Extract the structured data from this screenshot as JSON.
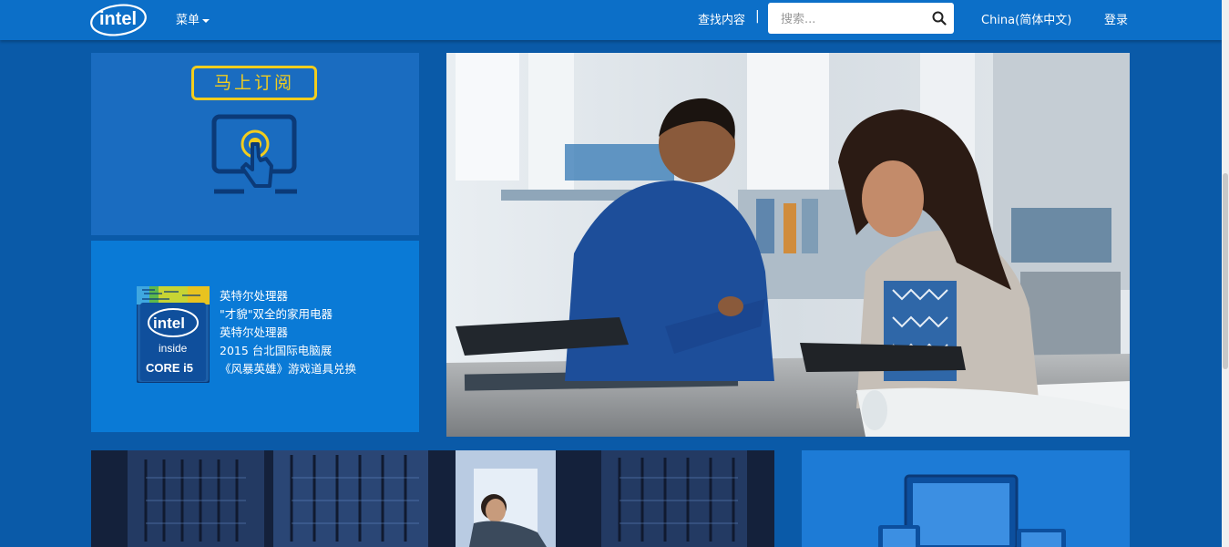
{
  "header": {
    "brand": "intel",
    "menu_label": "菜单",
    "find_content": "查找内容",
    "separator": "|",
    "search_placeholder": "搜索...",
    "language": "China(简体中文)",
    "login": "登录"
  },
  "tiles": {
    "subscribe": {
      "label": "马上订阅"
    },
    "processor": {
      "badge": {
        "brand": "intel",
        "inside": "inside",
        "model": "CORE i5"
      },
      "lines": [
        "英特尔处理器",
        "\"才貌\"双全的家用电器",
        "英特尔处理器",
        "2015 台北国际电脑展",
        "《风暴英雄》游戏道具兑换"
      ]
    }
  },
  "colors": {
    "page_bg": "#0a5aa8",
    "header_bg": "#0c6fc8",
    "accent_yellow": "#f2cd1e"
  },
  "icons": {
    "search": "magnifier-icon",
    "subscribe": "touch-screen-icon"
  }
}
